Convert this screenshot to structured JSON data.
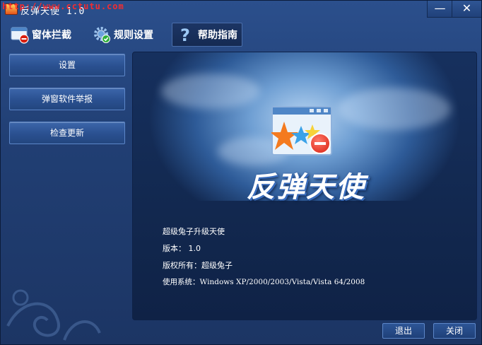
{
  "window": {
    "title": "反弹天使 1.0",
    "watermark": "http://www.cctutu.com",
    "minimize_glyph": "—",
    "close_glyph": "✕"
  },
  "nav": {
    "items": [
      {
        "label": "窗体拦截",
        "icon": "window-block-icon"
      },
      {
        "label": "规则设置",
        "icon": "gear-check-icon"
      },
      {
        "label": "帮助指南",
        "icon": "question-icon",
        "active": true
      }
    ]
  },
  "sidebar": {
    "buttons": [
      {
        "label": "设置"
      },
      {
        "label": "弹窗软件举报"
      },
      {
        "label": "检查更新"
      }
    ]
  },
  "about": {
    "logo_text": "反弹天使",
    "lines": [
      "超级兔子升级天使",
      "版本： 1.0",
      "版权所有：超级兔子",
      "使用系统：Windows XP/2000/2003/Vista/Vista 64/2008"
    ]
  },
  "footer": {
    "exit_label": "退出",
    "close_label": "关闭"
  },
  "colors": {
    "window_bg": "#213f74",
    "accent_red": "#ff2b2b",
    "button_border": "#5c86c8"
  }
}
